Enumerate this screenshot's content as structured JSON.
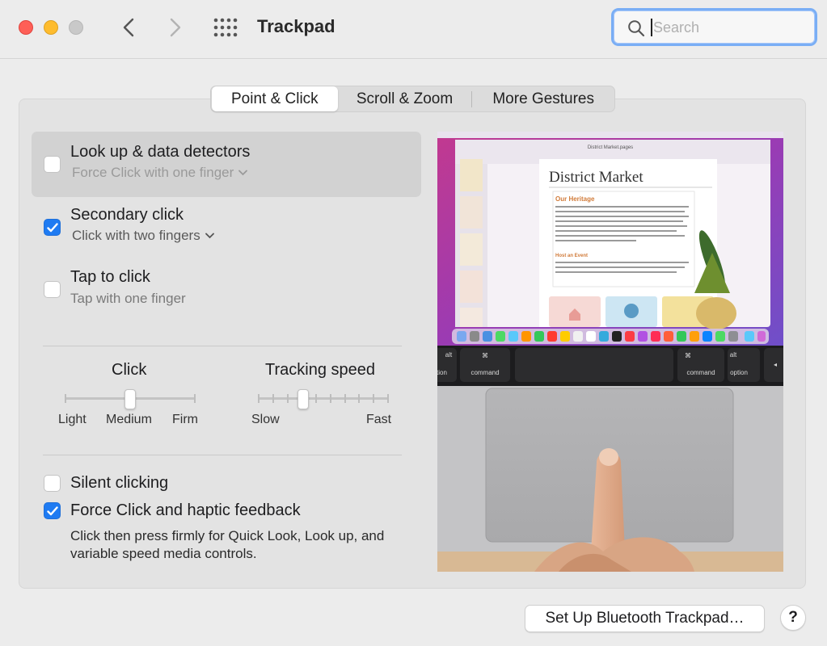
{
  "window": {
    "title": "Trackpad",
    "search_placeholder": "Search",
    "icons": [
      "close-button",
      "minimize-button",
      "zoom-button",
      "back-chevron-icon",
      "forward-chevron-icon",
      "grid-icon",
      "search-icon"
    ]
  },
  "tabs": [
    {
      "label": "Point & Click",
      "active": true
    },
    {
      "label": "Scroll & Zoom",
      "active": false
    },
    {
      "label": "More Gestures",
      "active": false
    }
  ],
  "options": {
    "lookup": {
      "label": "Look up & data detectors",
      "sub": "Force Click with one finger",
      "checked": false
    },
    "secondary": {
      "label": "Secondary click",
      "sub": "Click with two fingers",
      "checked": true
    },
    "tap": {
      "label": "Tap to click",
      "sub": "Tap with one finger",
      "checked": false
    },
    "silent": {
      "label": "Silent clicking",
      "checked": false
    },
    "force": {
      "label": "Force Click and haptic feedback",
      "checked": true,
      "desc": "Click then press firmly for Quick Look, Look up, and variable speed media controls."
    }
  },
  "sliders": {
    "click": {
      "title": "Click",
      "labels": [
        "Light",
        "Medium",
        "Firm"
      ],
      "value": "Medium"
    },
    "tracking": {
      "title": "Tracking speed",
      "min_label": "Slow",
      "max_label": "Fast",
      "ticks": 10,
      "value_index": 3
    }
  },
  "preview": {
    "doc_title": "District Market",
    "heading": "Our Heritage",
    "subheading": "Host an Event",
    "window_title": "District Market.pages",
    "key_labels": {
      "cmd": "command",
      "opt": "option",
      "alt": "alt",
      "opt_partial": "option"
    }
  },
  "footer": {
    "bluetooth_button": "Set Up Bluetooth Trackpad…",
    "help_button": "?"
  },
  "colors": {
    "accent": "#1f7bf2",
    "focus_ring": "#7aaef5"
  }
}
